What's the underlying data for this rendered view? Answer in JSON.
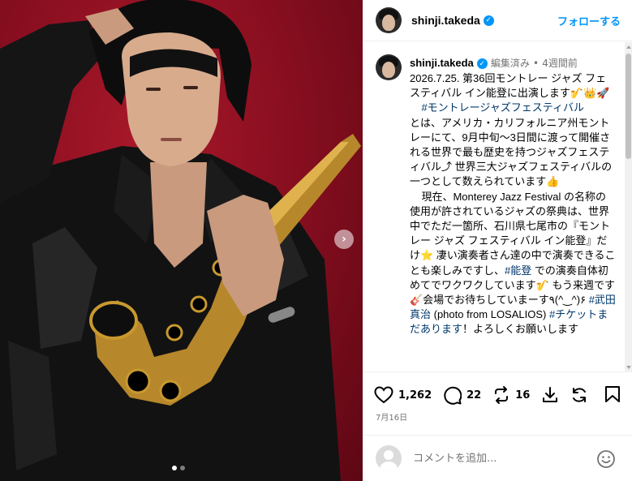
{
  "post": {
    "username": "shinji.takeda",
    "follow_label": "フォローする",
    "edited_label": "編集済み",
    "separator": "•",
    "time_ago": "4週間前",
    "caption_intro": "2026.7.25. 第36回モントレー ジャズ フェスティバル イン能登に出演します🎷👑🚀\n    ",
    "caption_tag1": "#モントレージャズフェスティバル",
    "caption_part2": "\nとは、アメリカ・カリフォルニア州モントレーにて、9月中旬〜3日間に渡って開催される世界で最も歴史を持つジャズフェスティバル⤴ 世界三大ジャズフェスティバルの一つとして数えられています👍\n    現在、Monterey Jazz Festival の名称の使用が許されているジャズの祭典は、世界中でただ一箇所、石川県七尾市の『モントレー ジャズ フェスティバル イン能登』だけ⭐ 凄い演奏者さん達の中で演奏できることも楽しみですし、",
    "caption_tag2": "#能登",
    "caption_part3": " での演奏自体初めてでワクワクしています🎷 もう来週です🎸会場でお待ちしていまーす٩(^‿^)۶ ",
    "caption_tag3": "#武田真治",
    "caption_part4": " (photo from LOSALIOS) ",
    "caption_tag4": "#チケットまだあります",
    "caption_part5": "！よろしくお願いします",
    "likes": "1,262",
    "comments": "22",
    "reposts": "16",
    "date": "7月16日"
  },
  "comment_box": {
    "placeholder": "コメントを追加..."
  },
  "icons": {
    "like": "heart-icon",
    "comment": "comment-bubble-icon",
    "repost": "repost-icon",
    "download": "download-icon",
    "refresh": "refresh-icon",
    "save": "bookmark-icon",
    "emoji": "emoji-icon",
    "next": "chevron-right-icon"
  },
  "colors": {
    "background_red": "#8a0f20",
    "accent_blue": "#0095f6",
    "hashtag": "#00376b",
    "muted": "#737373"
  },
  "carousel": {
    "current": 1,
    "total": 2
  }
}
